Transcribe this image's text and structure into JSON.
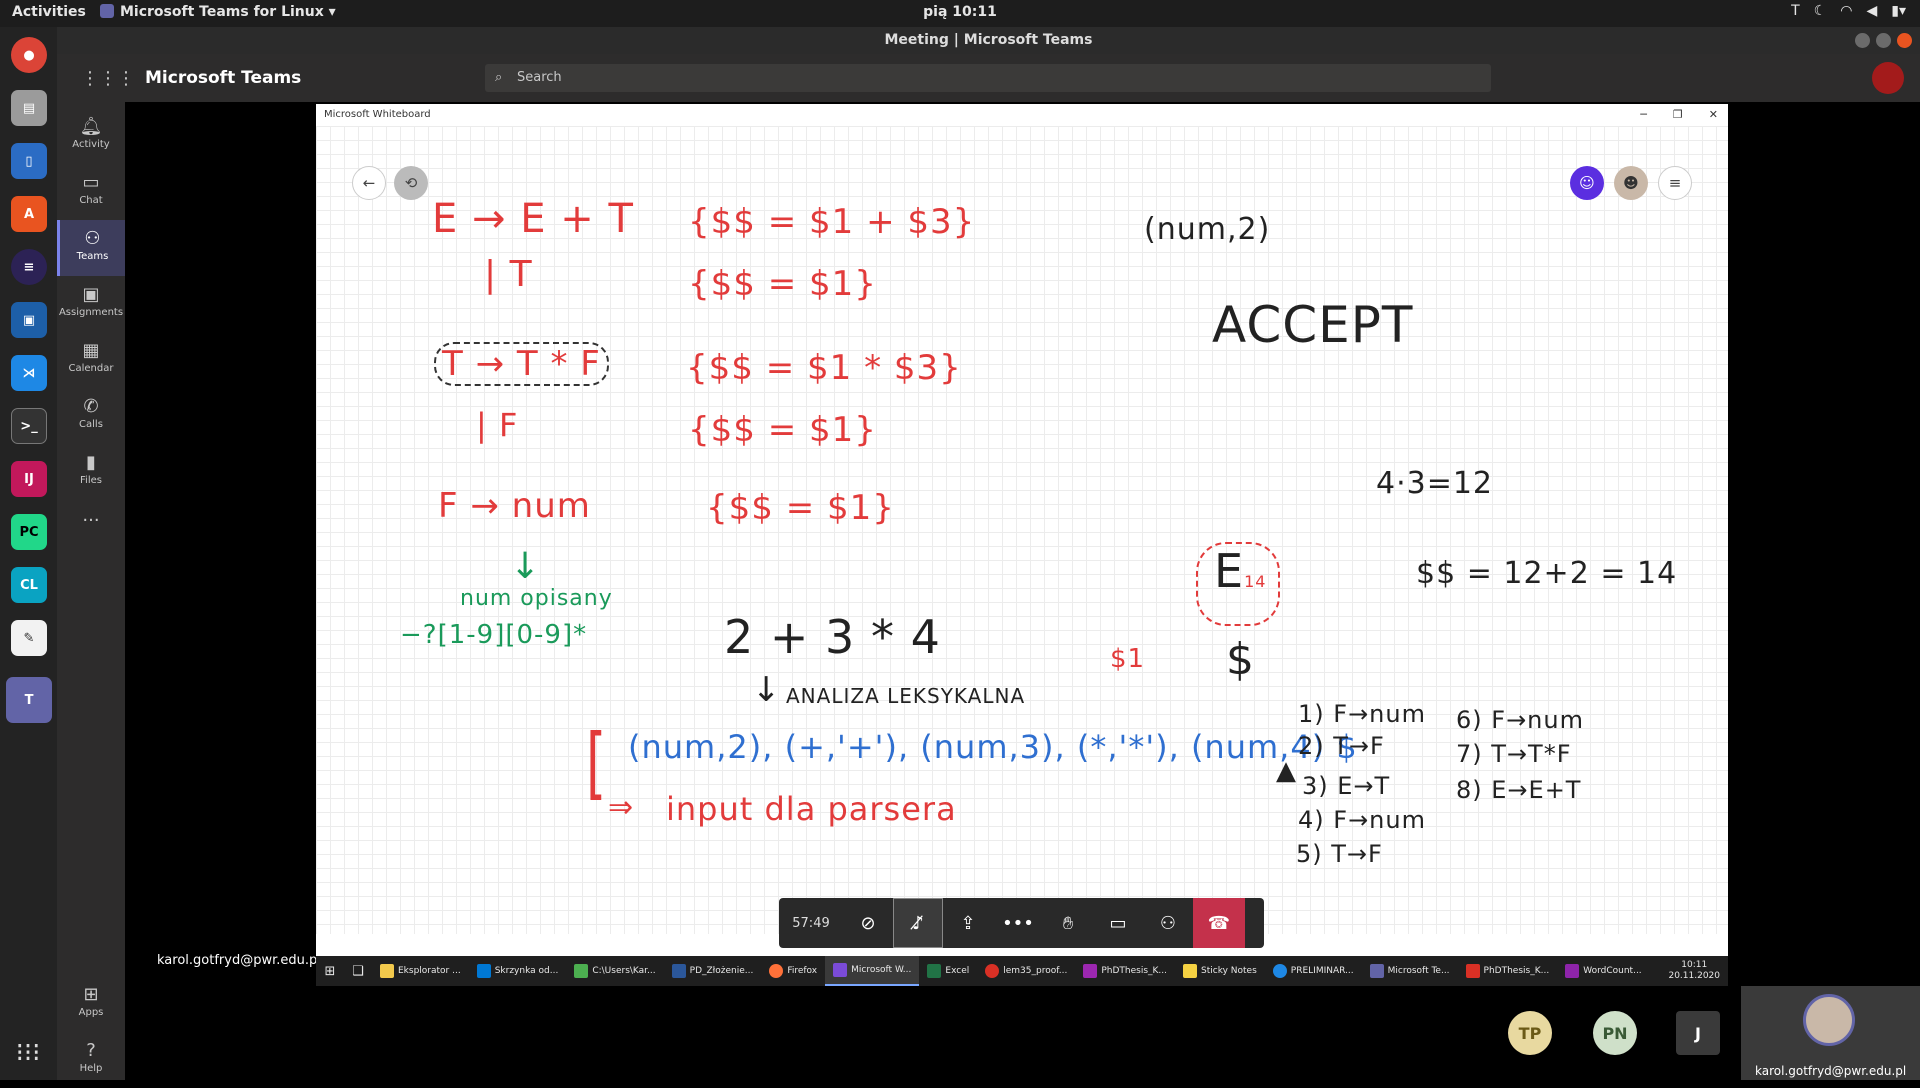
{
  "os_topbar": {
    "activities": "Activities",
    "app_menu": "Microsoft Teams for Linux",
    "clock": "pią 10:11"
  },
  "window_title": "Meeting | Microsoft Teams",
  "teams": {
    "brand": "Microsoft Teams",
    "search_placeholder": "Search",
    "rail": [
      {
        "label": "Activity",
        "icon": "bell-icon"
      },
      {
        "label": "Chat",
        "icon": "chat-icon"
      },
      {
        "label": "Teams",
        "icon": "teams-icon"
      },
      {
        "label": "Assignments",
        "icon": "bag-icon"
      },
      {
        "label": "Calendar",
        "icon": "calendar-icon"
      },
      {
        "label": "Calls",
        "icon": "phone-icon"
      },
      {
        "label": "Files",
        "icon": "file-icon"
      },
      {
        "label": "Apps",
        "icon": "apps-icon"
      },
      {
        "label": "Help",
        "icon": "help-icon"
      }
    ]
  },
  "stage": {
    "presenter_email": "karol.gotfryd@pwr.edu.pl"
  },
  "whiteboard": {
    "title": "Microsoft Whiteboard",
    "lines": {
      "g1": "E → E + T",
      "g2": "| T",
      "g3": "T → T * F",
      "g4": "| F",
      "g5": "F → num",
      "a1": "{$$ = $1 + $3}",
      "a2": "{$$ = $1}",
      "a3": "{$$ = $1 * $3}",
      "a4": "{$$ = $1}",
      "a5": "{$$ = $1}",
      "note1": "num opisany",
      "note2": "−?[1-9][0-9]*",
      "expr": "2 + 3 * 4",
      "lex": "ANALIZA LEKSYKALNA",
      "tokens": "(num,2), (+,'+'), (num,3), (*,'*'), (num,4) $",
      "input": "input dla parsera",
      "numtok": "(num,2)",
      "accept": "ACCEPT",
      "calc1": "4·3=12",
      "calc2": "$$ = 12+2 = 14",
      "E": "E",
      "E_sub": "14",
      "dollar": "$",
      "s1": "$1",
      "r1": "1) F→num",
      "r2": "2) T→F",
      "r3": "3) E→T",
      "r4": "4) F→num",
      "r5": "5) T→F",
      "r6": "6) F→num",
      "r7": "7) T→T*F",
      "r8": "8) E→E+T"
    }
  },
  "taskbar": {
    "items": [
      "Eksplorator ...",
      "Skrzynka od...",
      "C:\\Users\\Kar...",
      "PD_Złożenie...",
      "Firefox",
      "Microsoft W...",
      "Excel",
      "lem35_proof...",
      "PhDThesis_K...",
      "Sticky Notes",
      "PRELIMINAR...",
      "Microsoft Te...",
      "PhDThesis_K...",
      "WordCount..."
    ],
    "time": "10:11",
    "date": "20.11.2020"
  },
  "meeting_controls": {
    "timer": "57:49"
  },
  "participants": [
    {
      "initials": "TP",
      "color": "#e8d9a0"
    },
    {
      "initials": "PN",
      "color": "#cfe0c9"
    },
    {
      "initials": "J",
      "color": "#3a3a3a"
    }
  ],
  "self_view": {
    "label": "karol.gotfryd@pwr.edu.pl"
  }
}
